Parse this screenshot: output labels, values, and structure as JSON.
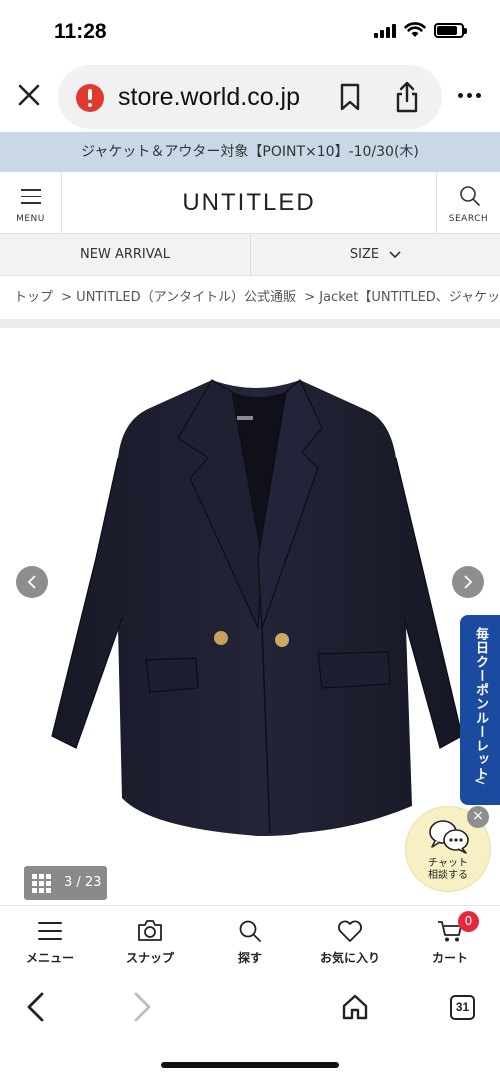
{
  "status_bar": {
    "time": "11:28"
  },
  "browser": {
    "url": "store.world.co.jp",
    "tab_count": "31"
  },
  "promo": {
    "text": "ジャケット＆アウター対象【POINT×10】-10/30(木)"
  },
  "header": {
    "menu_label": "MENU",
    "logo": "UNTITLED",
    "search_label": "SEARCH"
  },
  "nav": {
    "new_arrival": "NEW ARRIVAL",
    "size": "SIZE"
  },
  "breadcrumb": {
    "items": [
      "トップ",
      "> UNTITLED（アンタイトル）公式通販",
      "> Jacket【UNTITLED、ジャケット】"
    ]
  },
  "gallery": {
    "counter": "3 / 23"
  },
  "roulette": {
    "label": "毎日クーポンルーレット",
    "chevron": "<"
  },
  "chat": {
    "line1": "チャット",
    "line2": "相談する",
    "close": "×"
  },
  "app_nav": {
    "items": [
      {
        "label": "メニュー",
        "icon": "hamburger-icon"
      },
      {
        "label": "スナップ",
        "icon": "camera-icon"
      },
      {
        "label": "探す",
        "icon": "search-icon"
      },
      {
        "label": "お気に入り",
        "icon": "heart-icon"
      },
      {
        "label": "カート",
        "icon": "cart-icon"
      }
    ],
    "cart_badge": "0"
  },
  "colors": {
    "promo_bg": "#c9d7e6",
    "roulette_bg": "#1b4ba0",
    "badge_red": "#e6283c",
    "chat_bg": "#f6f0c4",
    "jacket_navy": "#1b1c2b"
  }
}
